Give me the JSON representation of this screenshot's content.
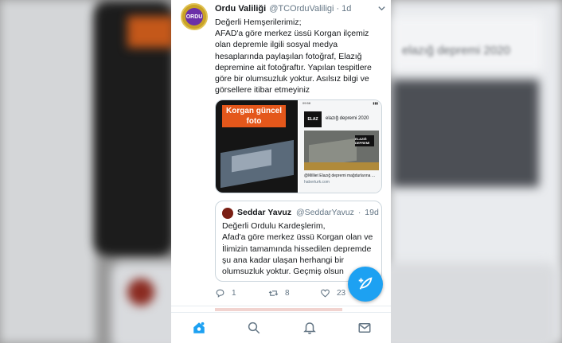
{
  "tweet": {
    "display_name": "Ordu Valiliği",
    "handle": "@TCOrduValiligi",
    "separator": "·",
    "time": "1d",
    "avatar_text": "ORDU",
    "lines": [
      "Değerli Hemşerilerimiz;",
      "AFAD'a göre merkez üssü Korgan ilçemiz",
      "olan depremle ilgili sosyal medya",
      "hesaplarında paylaşılan fotoğraf, Elazığ",
      "depremine ait fotoğraftır. Yapılan tespitlere",
      "göre bir olumsuzluk yoktur. Asılsız bilgi ve",
      "görsellere itibar etmeyiniz"
    ]
  },
  "media": {
    "left_caption": "Korgan güncel foto",
    "right_status_time": "09:58",
    "right_logo": "ELAZ",
    "right_query": "elazığ depremi 2020",
    "right_badge": "ELAZIĞ DEPREMİ",
    "right_caption": "@Milliet Elazığ depremi mağdurlarına ...",
    "right_source": "haberturk.com"
  },
  "quote": {
    "display_name": "Seddar Yavuz",
    "handle": "@SeddarYavuz",
    "separator": "·",
    "time": "19d",
    "lines": [
      "Değerli Ordulu Kardeşlerim,",
      "Afad'a göre merkez üssü Korgan olan ve",
      "İlimizin tamamında hissedilen depremde",
      "şu ana kadar ulaşan herhangi bir",
      "olumsuzluk yoktur. Geçmiş olsun"
    ]
  },
  "actions": {
    "replies": "1",
    "retweets": "8",
    "likes": "23"
  },
  "background": {
    "blurred_text": "elazığ depremi 2020"
  },
  "colors": {
    "accent": "#1da1f2",
    "text": "#14171a",
    "muted": "#657786",
    "border": "#ccd6dd"
  },
  "icons": {
    "home": "home-icon",
    "search": "search-icon",
    "notifications": "bell-icon",
    "messages": "mail-icon",
    "compose": "compose-feather-icon"
  }
}
